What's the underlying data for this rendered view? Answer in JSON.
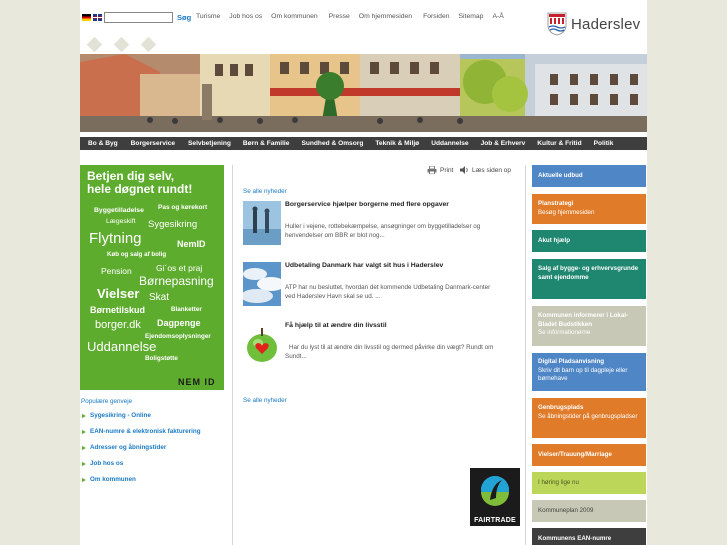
{
  "header": {
    "search_placeholder": "",
    "search_button": "Søg",
    "top_links": [
      "Turisme",
      "Job hos os",
      "Om kommunen",
      "Presse",
      "Om hjemmesiden",
      "Forsiden",
      "Sitemap",
      "A-Å"
    ],
    "logo_text": "Haderslev"
  },
  "main_nav": [
    "Bo & Byg",
    "Borgerservice",
    "Selvbetjening",
    "Børn & Familie",
    "Sundhed & Omsorg",
    "Teknik & Miljø",
    "Uddannelse",
    "Job & Erhverv",
    "Kultur & Fritid",
    "Politik"
  ],
  "selfservice": {
    "title_line1": "Betjen dig selv,",
    "title_line2": "hele døgnet rundt!",
    "words": [
      "Byggetilladelse",
      "Pas og kørekort",
      "Lægeskift",
      "Sygesikring",
      "Flytning",
      "NemID",
      "Køb og salg af bolig",
      "Pension",
      "Gi´os et praj",
      "Børnepasning",
      "Vielser",
      "Skat",
      "Børnetilskud",
      "Blanketter",
      "borger.dk",
      "Dagpenge",
      "Ejendomsoplysninger",
      "Uddannelse",
      "Boligstøtte"
    ],
    "nemid_badge": "NEM ID"
  },
  "popular": {
    "title": "Populære genveje",
    "links": [
      "Sygesikring - Online",
      "EAN-numre & elektronisk fakturering",
      "Adresser og åbningstider",
      "Job hos os",
      "Om kommunen"
    ]
  },
  "tools": {
    "print": "Print",
    "listen": "Læs siden op"
  },
  "news": {
    "see_all_top": "Se alle nyheder",
    "see_all_bottom": "Se alle nyheder",
    "items": [
      {
        "title": "Borgerservice hjælper borgerne med flere opgaver",
        "line1": "Huller i vejene, rottebekæmpelse, ansøgninger om byggetilladelser og",
        "line2": "henvendelser om BBR er blot nog..."
      },
      {
        "title": "Udbetaling Danmark har valgt sit hus i Haderslev",
        "line1": "ATP har nu besluttet, hvordan det kommende Udbetaling Danmark-center",
        "line2": "ved Haderslev Havn skal se ud. ..."
      },
      {
        "title": "Få hjælp til at ændre din livsstil",
        "line1": "Har du lyst til at ændre din livsstil og dermed påvirke din vægt? Rundt om",
        "line2": "Sundt..."
      }
    ]
  },
  "fairtrade_label": "FAIRTRADE",
  "right_boxes": [
    {
      "title": "Aktuelle udbud",
      "sub": "",
      "color": "#4f86c6"
    },
    {
      "title": "Planstrategi",
      "sub": "Besøg hjemmesiden",
      "color": "#e07b29"
    },
    {
      "title": "Akut hjælp",
      "sub": "",
      "color": "#1f8670"
    },
    {
      "title": "Salg af bygge- og erhvervsgrunde samt ejendomme",
      "sub": "",
      "color": "#1f8670"
    },
    {
      "title": "Kommunen informerer i Lokal-Bladet Budstikken",
      "sub": "Se informationerne",
      "color": "#c8c8b6"
    },
    {
      "title": "Digital Pladsanvisning",
      "sub": "Skriv dit barn op til dagpleje eller børnehave",
      "color": "#4f86c6"
    },
    {
      "title": "Genbrugsplads",
      "sub": "Se åbningstider på genbrugspladser",
      "color": "#e07b29"
    },
    {
      "title": "Vielser/Trauung/Marriage",
      "sub": "",
      "color": "#e07b29"
    },
    {
      "title": "",
      "sub": "I høring lige nu",
      "color": "#bcd65a"
    },
    {
      "title": "",
      "sub": "Kommuneplan 2009",
      "color": "#c8c8b6"
    },
    {
      "title": "Kommunens EAN-numre",
      "sub": "",
      "color": "#3e3e3e"
    }
  ]
}
